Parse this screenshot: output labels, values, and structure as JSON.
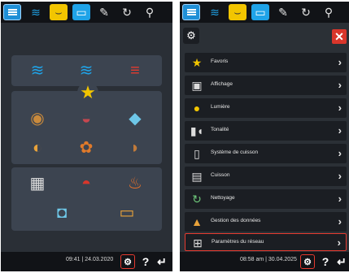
{
  "left_screen": {
    "timestamp": "09:41 | 24.03.2020",
    "help_label": "?",
    "back_label": "↵"
  },
  "right_screen": {
    "timestamp": "08:58 am | 30.04.2025",
    "help_label": "?",
    "back_label": "↵",
    "menu_items": [
      {
        "label": "Favoris",
        "icon": "star-icon"
      },
      {
        "label": "Affichage",
        "icon": "display-icon"
      },
      {
        "label": "Lumière",
        "icon": "light-bulb-icon"
      },
      {
        "label": "Tonalité",
        "icon": "speaker-icon"
      },
      {
        "label": "Système de cuisson",
        "icon": "oven-system-icon"
      },
      {
        "label": "Cuisson",
        "icon": "cooking-icon"
      },
      {
        "label": "Nettoyage",
        "icon": "cleaning-icon"
      },
      {
        "label": "Gestion des données",
        "icon": "data-management-icon"
      },
      {
        "label": "Paramètres du réseau",
        "icon": "network-icon"
      }
    ]
  },
  "colors": {
    "accent_blue": "#1f8fd6",
    "accent_yellow": "#f2c500",
    "accent_red": "#e53a2f"
  }
}
